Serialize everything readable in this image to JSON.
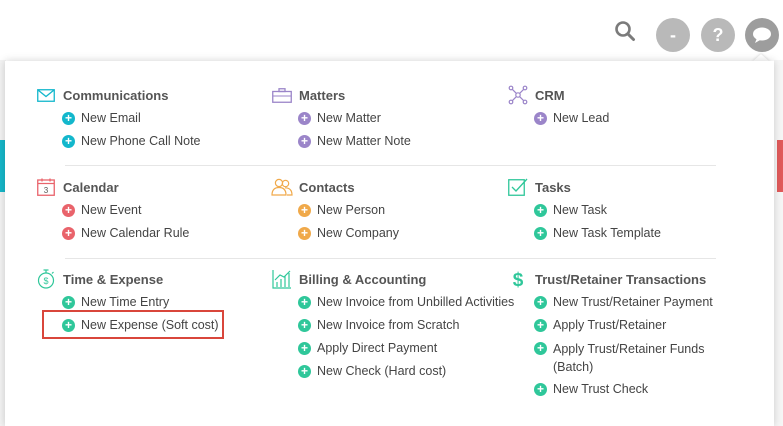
{
  "colors": {
    "cyan": "#13b7cc",
    "purple": "#9b85c9",
    "red": "#e9636b",
    "orange": "#f0a94a",
    "green": "#2fc79a",
    "highlight": "#d9463b"
  },
  "top_icons": [
    "search-icon",
    "minus-icon",
    "help-icon",
    "chat-icon"
  ],
  "top": {
    "minus": "-",
    "help": "?"
  },
  "sections": {
    "communications": {
      "title": "Communications",
      "items": [
        "New Email",
        "New Phone Call Note"
      ]
    },
    "matters": {
      "title": "Matters",
      "items": [
        "New Matter",
        "New Matter Note"
      ]
    },
    "crm": {
      "title": "CRM",
      "items": [
        "New Lead"
      ]
    },
    "calendar": {
      "title": "Calendar",
      "icon_text": "3",
      "items": [
        "New Event",
        "New Calendar Rule"
      ]
    },
    "contacts": {
      "title": "Contacts",
      "items": [
        "New Person",
        "New Company"
      ]
    },
    "tasks": {
      "title": "Tasks",
      "items": [
        "New Task",
        "New Task Template"
      ]
    },
    "time_expense": {
      "title": "Time & Expense",
      "items": [
        "New Time Entry",
        "New Expense (Soft cost)"
      ]
    },
    "billing": {
      "title": "Billing & Accounting",
      "items": [
        "New Invoice from Unbilled Activities",
        "New Invoice from Scratch",
        "Apply Direct Payment",
        "New Check (Hard cost)"
      ]
    },
    "trust": {
      "title": "Trust/Retainer Transactions",
      "items": [
        "New Trust/Retainer Payment",
        "Apply Trust/Retainer",
        "Apply Trust/Retainer Funds (Batch)",
        "New Trust Check"
      ]
    }
  }
}
